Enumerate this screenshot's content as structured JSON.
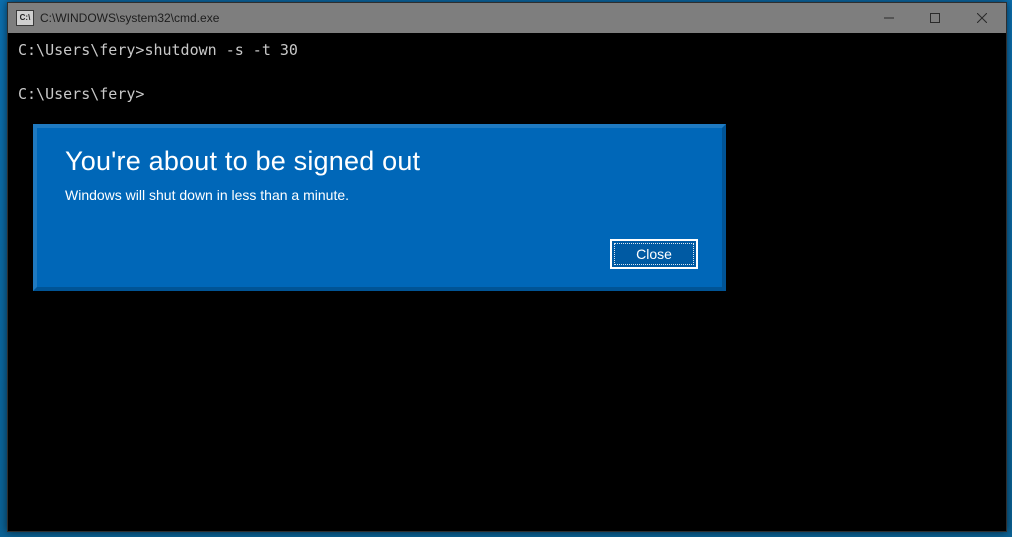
{
  "cmd": {
    "title": "C:\\WINDOWS\\system32\\cmd.exe",
    "icon_label": "C:\\",
    "lines": [
      {
        "prompt": "C:\\Users\\fery>",
        "command": "shutdown -s -t 30"
      },
      {
        "prompt": "C:\\Users\\fery>",
        "command": ""
      }
    ],
    "controls": {
      "minimize": "minimize",
      "maximize": "maximize",
      "close": "close"
    }
  },
  "dialog": {
    "title": "You're about to be signed out",
    "message": "Windows will shut down in less than a minute.",
    "close_label": "Close"
  },
  "colors": {
    "dialog_bg": "#0067b8",
    "desktop_bg": "#0b6aa8"
  }
}
